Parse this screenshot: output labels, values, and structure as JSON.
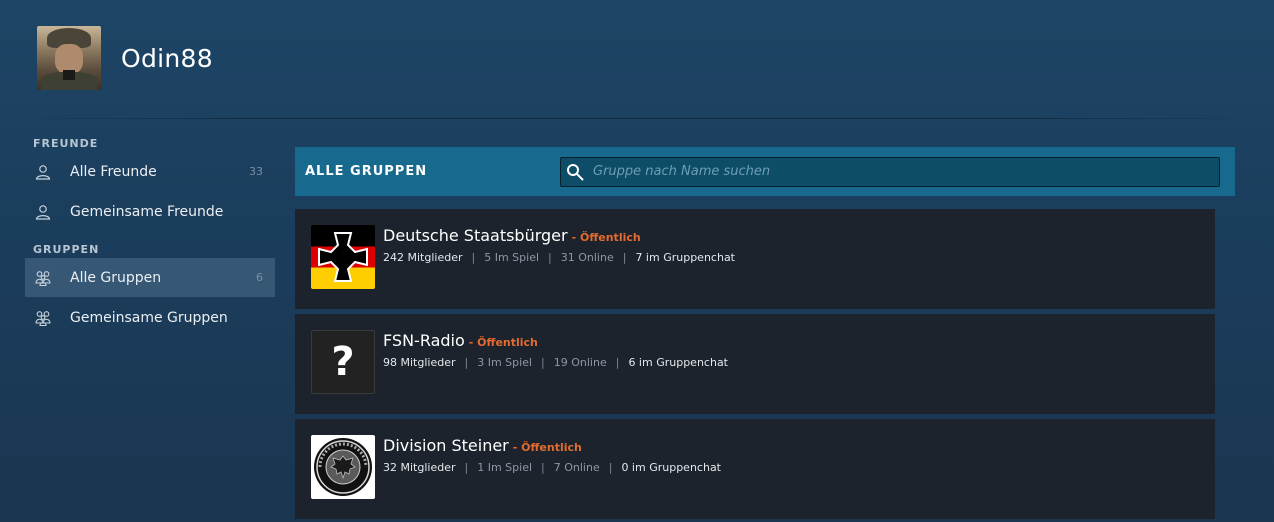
{
  "profile": {
    "username": "Odin88",
    "avatar_icon": "user-avatar"
  },
  "sidebar": {
    "friends_heading": "FREUNDE",
    "friends_items": [
      {
        "label": "Alle Freunde",
        "count": "33",
        "icon": "person-icon"
      },
      {
        "label": "Gemeinsame Freunde",
        "count": "",
        "icon": "person-icon"
      }
    ],
    "groups_heading": "GRUPPEN",
    "groups_items": [
      {
        "label": "Alle Gruppen",
        "count": "6",
        "icon": "group-icon",
        "active": true
      },
      {
        "label": "Gemeinsame Gruppen",
        "count": "",
        "icon": "group-icon"
      }
    ]
  },
  "main": {
    "title": "ALLE GRUPPEN",
    "search": {
      "placeholder": "Gruppe nach Name suchen",
      "value": ""
    },
    "groups": [
      {
        "name": "Deutsche Staatsbürger",
        "privacy": "- Öffentlich",
        "members": "242 Mitglieder",
        "in_game": "5 Im Spiel",
        "online": "31 Online",
        "in_chat": "7 im Gruppenchat",
        "avatar_icon": "iron-cross-flag-icon"
      },
      {
        "name": "FSN-Radio",
        "privacy": "- Öffentlich",
        "members": "98 Mitglieder",
        "in_game": "3 Im Spiel",
        "online": "19 Online",
        "in_chat": "6 im Gruppenchat",
        "avatar_icon": "question-mark-icon",
        "avatar_glyph": "?"
      },
      {
        "name": "Division Steiner",
        "privacy": "- Öffentlich",
        "members": "32 Mitglieder",
        "in_game": "1 Im Spiel",
        "online": "7 Online",
        "in_chat": "0 im Gruppenchat",
        "avatar_icon": "eagle-seal-icon"
      }
    ]
  },
  "colors": {
    "accent": "#17698e",
    "privacy": "#e36b2f",
    "row_bg": "#1c232c"
  }
}
